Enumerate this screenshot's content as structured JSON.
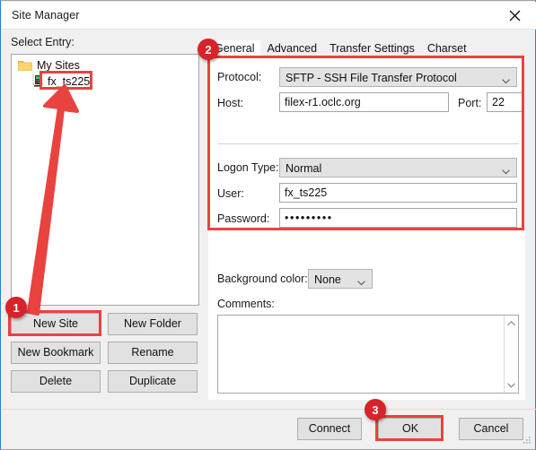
{
  "window": {
    "title": "Site Manager",
    "close_icon": "close-icon"
  },
  "left": {
    "select_entry_label": "Select Entry:",
    "tree": {
      "root": {
        "label": "My Sites",
        "icon": "folder-icon"
      },
      "child": {
        "label": "fx_ts225",
        "icon": "server-icon"
      }
    },
    "buttons": [
      {
        "label": "New Site"
      },
      {
        "label": "New Folder"
      },
      {
        "label": "New Bookmark"
      },
      {
        "label": "Rename"
      },
      {
        "label": "Delete"
      },
      {
        "label": "Duplicate"
      }
    ]
  },
  "right": {
    "tabs": [
      {
        "label": "General",
        "active": true
      },
      {
        "label": "Advanced",
        "active": false
      },
      {
        "label": "Transfer Settings",
        "active": false
      },
      {
        "label": "Charset",
        "active": false
      }
    ],
    "fields": {
      "protocol_label": "Protocol:",
      "protocol_value": "SFTP - SSH File Transfer Protocol",
      "host_label": "Host:",
      "host_value": "filex-r1.oclc.org",
      "port_label": "Port:",
      "port_value": "22",
      "logon_type_label": "Logon Type:",
      "logon_type_value": "Normal",
      "user_label": "User:",
      "user_value": "fx_ts225",
      "password_label": "Password:",
      "password_value": "•••••••••",
      "background_color_label": "Background color:",
      "background_color_value": "None",
      "comments_label": "Comments:",
      "comments_value": ""
    }
  },
  "footer": {
    "buttons": [
      {
        "label": "Connect"
      },
      {
        "label": "OK"
      },
      {
        "label": "Cancel"
      }
    ]
  },
  "annotations": {
    "badges": [
      {
        "label": "1"
      },
      {
        "label": "2"
      },
      {
        "label": "3"
      }
    ],
    "accent_color": "#e8433f",
    "badge_color": "#d8232a"
  }
}
